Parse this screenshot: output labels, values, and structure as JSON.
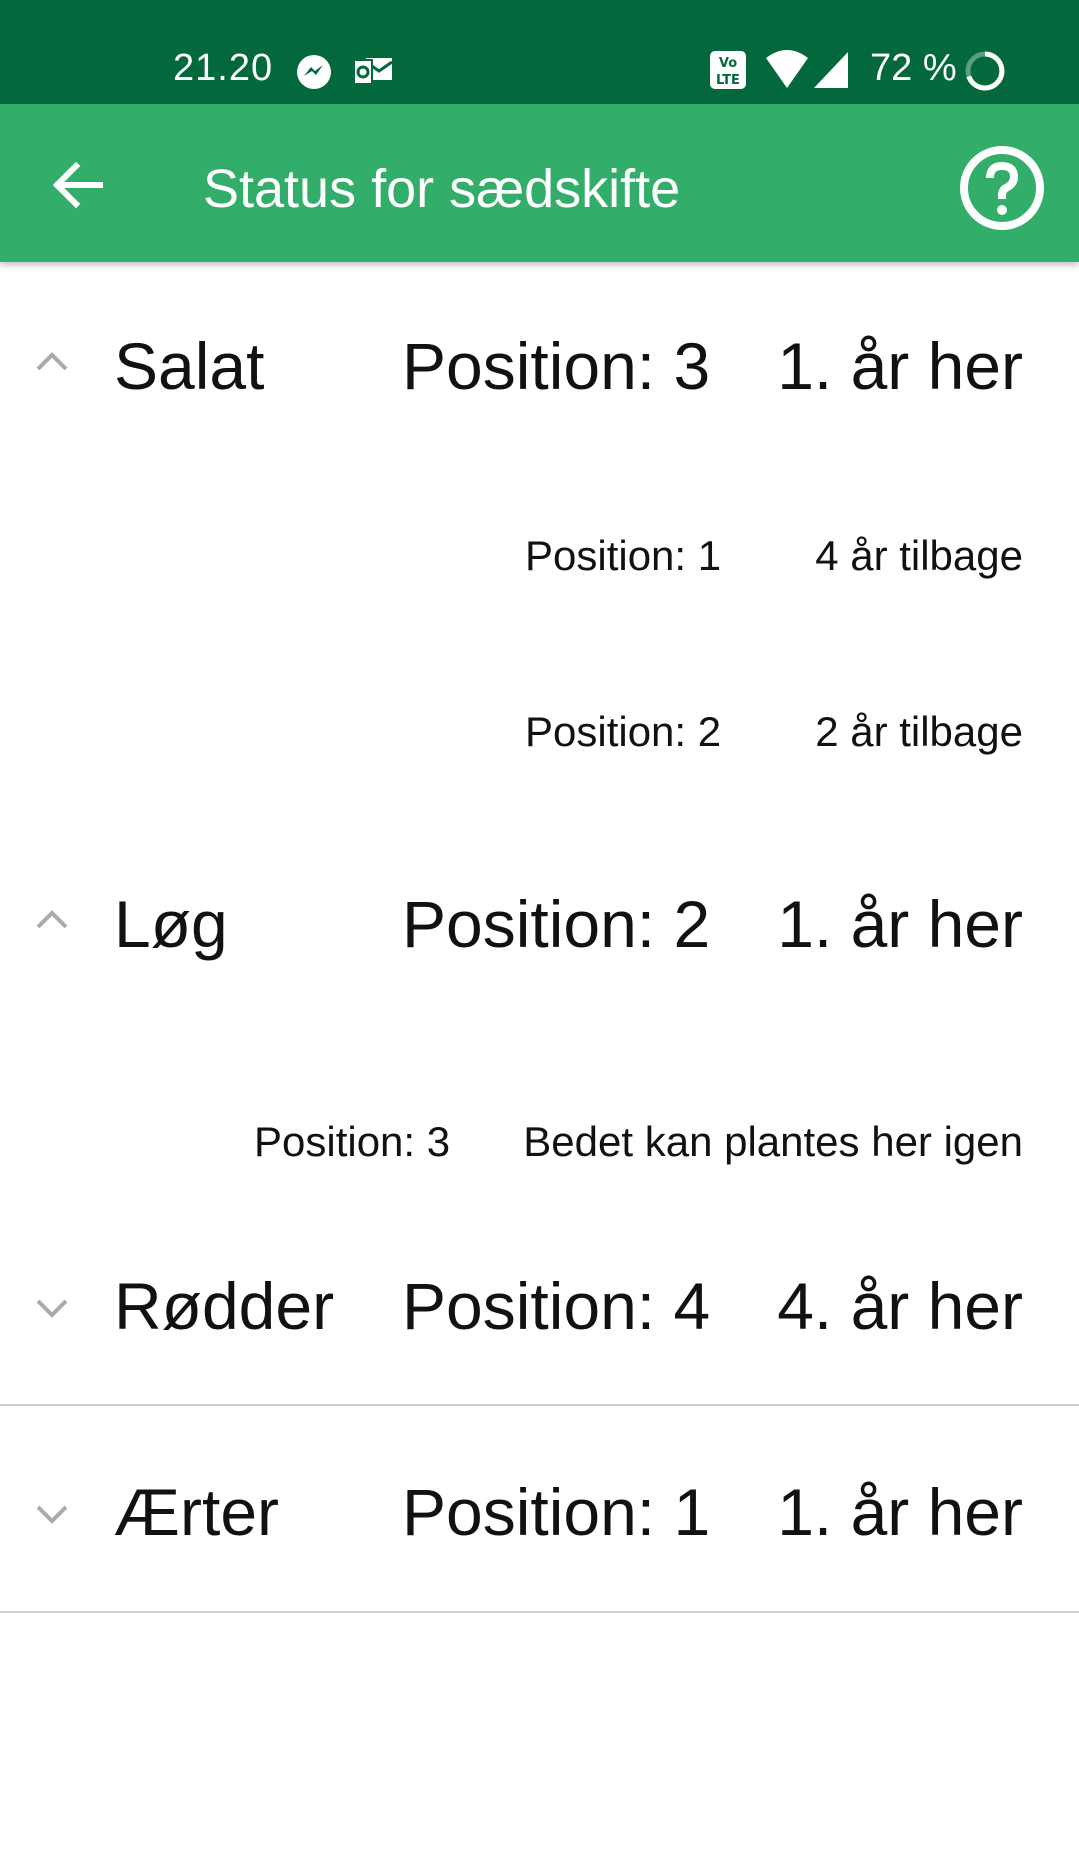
{
  "status_bar": {
    "time": "21.20",
    "battery_percent": "72 %",
    "icons": [
      "messenger-icon",
      "outlook-icon",
      "volte-icon",
      "wifi-icon",
      "signal-icon",
      "battery-icon"
    ]
  },
  "app_bar": {
    "title": "Status for sædskifte",
    "back_icon": "arrow-left-icon",
    "help_icon": "help-circle-icon"
  },
  "colors": {
    "status_bar_bg": "#03693d",
    "app_bar_bg": "#33ad6a"
  },
  "crops": [
    {
      "name": "Salat",
      "position": "Position: 3",
      "year": "1. år her",
      "expanded": true,
      "history": [
        {
          "position": "Position: 1",
          "note": "4 år tilbage"
        },
        {
          "position": "Position: 2",
          "note": "2 år tilbage"
        }
      ]
    },
    {
      "name": "Løg",
      "position": "Position: 2",
      "year": "1. år her",
      "expanded": true,
      "history": [
        {
          "position": "Position: 3",
          "note": "Bedet kan plantes her igen"
        }
      ]
    },
    {
      "name": "Rødder",
      "position": "Position: 4",
      "year": "4. år her",
      "expanded": false,
      "history": []
    },
    {
      "name": "Ærter",
      "position": "Position: 1",
      "year": "1. år her",
      "expanded": false,
      "history": []
    }
  ]
}
